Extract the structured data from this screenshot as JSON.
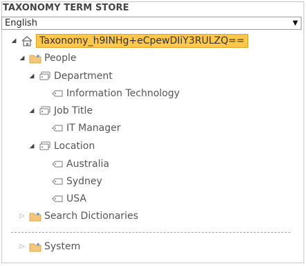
{
  "header": {
    "title": "TAXONOMY TERM STORE"
  },
  "language": {
    "selected": "English"
  },
  "tree": {
    "root": "Taxonomy_h9INHg+eCpewDIiY3RULZQ==",
    "people": "People",
    "department": "Department",
    "information_technology": "Information Technology",
    "job_title": "Job Title",
    "it_manager": "IT Manager",
    "location": "Location",
    "australia": "Australia",
    "sydney": "Sydney",
    "usa": "USA",
    "search_dictionaries": "Search Dictionaries",
    "system": "System"
  },
  "icons": {
    "expanded": "triangle-down-icon",
    "collapsed": "triangle-right-icon",
    "root": "home-icon",
    "group": "folder-icon",
    "termset": "termset-icon",
    "term": "tag-icon"
  },
  "colors": {
    "selection": "#ffc84a",
    "separator": "#7aa7d8"
  }
}
